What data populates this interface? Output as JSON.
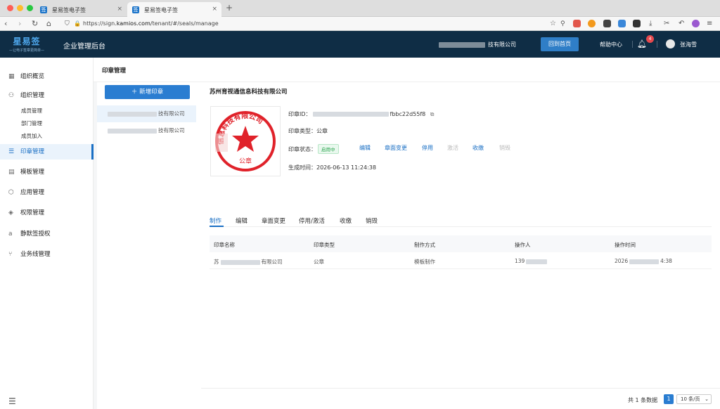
{
  "browser": {
    "tabs": [
      {
        "label": "星易签电子签",
        "favicon": "签"
      },
      {
        "label": "星易签电子签",
        "favicon": "签"
      }
    ],
    "url_prefix": "https://sign.",
    "url_host": "kamios.com",
    "url_path": "/tenant/#/seals/manage"
  },
  "header": {
    "logo_main": "星易签",
    "logo_tagline": "—让电子签章更简单—",
    "title": "企业管理后台",
    "company": "技有限公司",
    "home_button": "回到首页",
    "help": "帮助中心",
    "notification_count": "4",
    "user_name": "张海雪"
  },
  "sidebar": {
    "items": [
      {
        "label": "组织概览",
        "icon": "grid-icon"
      },
      {
        "label": "组织管理",
        "icon": "org-icon"
      },
      {
        "label": "印章管理",
        "icon": "seal-icon"
      },
      {
        "label": "模板管理",
        "icon": "template-icon"
      },
      {
        "label": "应用管理",
        "icon": "cube-icon"
      },
      {
        "label": "权限管理",
        "icon": "shield-icon"
      },
      {
        "label": "静默签授权",
        "icon": "auth-icon"
      },
      {
        "label": "业务线管理",
        "icon": "branch-icon"
      }
    ],
    "sub_items": [
      "成员管理",
      "部门管理",
      "成员加入"
    ]
  },
  "page": {
    "title": "印章管理",
    "new_seal_button": "新增印章",
    "seal_list": [
      {
        "suffix": "技有限公司"
      },
      {
        "suffix": "技有限公司"
      }
    ]
  },
  "detail": {
    "company": "苏州育视通信息科技有限公司",
    "seal_id_label": "印章ID：",
    "seal_id_tail": "fbbc22d55f8",
    "seal_type_label": "印章类型：",
    "seal_type": "公章",
    "seal_status_label": "印章状态：",
    "seal_status": "启用中",
    "created_label": "生成时间：",
    "created": "2026-06-13 11:24:38",
    "actions": [
      "编辑",
      "章面变更",
      "停用",
      "激活",
      "收缴",
      "销毁"
    ],
    "seal_image_text": "信息科技有限公司",
    "seal_image_label": "公章"
  },
  "tabs": [
    "制作",
    "编辑",
    "章面变更",
    "停用/激活",
    "收缴",
    "销毁"
  ],
  "table": {
    "columns": [
      "印章名称",
      "印章类型",
      "制作方式",
      "操作人",
      "操作时间"
    ],
    "rows": [
      {
        "name_prefix": "苏",
        "name_suffix": "有限公司",
        "type": "公章",
        "method": "模板制作",
        "operator": "139",
        "time_prefix": "2026",
        "time_suffix": "4:38"
      }
    ]
  },
  "pagination": {
    "total": "共 1 条数据",
    "current": "1",
    "page_size": "10 条/页"
  },
  "colors": {
    "header_bg": "#0f2d45",
    "accent": "#1a6fc4",
    "seal_red": "#e0222a",
    "status_green": "#2ba44e"
  }
}
